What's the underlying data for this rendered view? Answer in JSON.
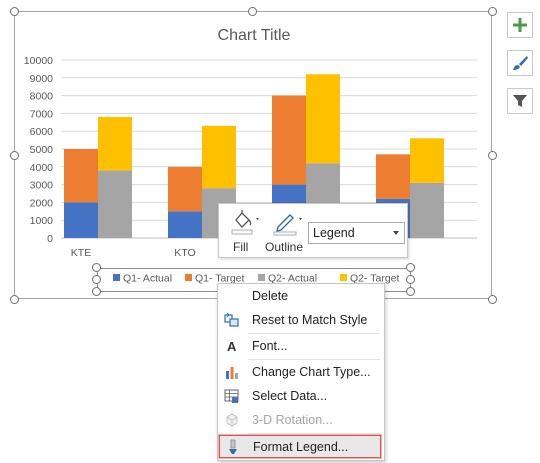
{
  "chart_data": {
    "type": "bar",
    "title": "Chart Title",
    "stacked": true,
    "categories": [
      "KTE",
      "KTO",
      "",
      ""
    ],
    "ylim": [
      0,
      10000
    ],
    "yticks": [
      0,
      1000,
      2000,
      3000,
      4000,
      5000,
      6000,
      7000,
      8000,
      9000,
      10000
    ],
    "grid": true,
    "legend_position": "bottom",
    "stacks": [
      {
        "group": "Q1",
        "series": [
          {
            "name": "Q1- Actual",
            "color": "#4472c4",
            "values": [
              2000,
              1500,
              3000,
              2200
            ]
          },
          {
            "name": "Q1- Target",
            "color": "#ed7d31",
            "values": [
              3000,
              2500,
              5000,
              2500
            ]
          }
        ]
      },
      {
        "group": "Q2",
        "series": [
          {
            "name": "Q2- Actual",
            "color": "#a5a5a5",
            "values": [
              3800,
              2800,
              4200,
              3100
            ]
          },
          {
            "name": "Q2- Target",
            "color": "#ffc000",
            "values": [
              3000,
              3500,
              5000,
              2500
            ]
          }
        ]
      }
    ]
  },
  "side_tools": [
    {
      "icon": "plus-icon",
      "color": "#4a9a4a"
    },
    {
      "icon": "brush-icon",
      "color": "#2e6db4"
    },
    {
      "icon": "filter-icon",
      "color": "#555555"
    }
  ],
  "mini_toolbar": {
    "fill_label": "Fill",
    "outline_label": "Outline",
    "selected_element": "Legend"
  },
  "context_menu": {
    "items": [
      {
        "label": "Delete",
        "icon": "",
        "disabled": false
      },
      {
        "label": "Reset to Match Style",
        "icon": "reset-style-icon",
        "disabled": false
      },
      {
        "label": "Font...",
        "icon": "font-icon",
        "disabled": false
      },
      {
        "label": "Change Chart Type...",
        "icon": "chart-type-icon",
        "disabled": false
      },
      {
        "label": "Select Data...",
        "icon": "select-data-icon",
        "disabled": false
      },
      {
        "label": "3-D Rotation...",
        "icon": "rotation-icon",
        "disabled": true
      },
      {
        "label": "Format Legend...",
        "icon": "format-icon",
        "disabled": false
      }
    ]
  }
}
